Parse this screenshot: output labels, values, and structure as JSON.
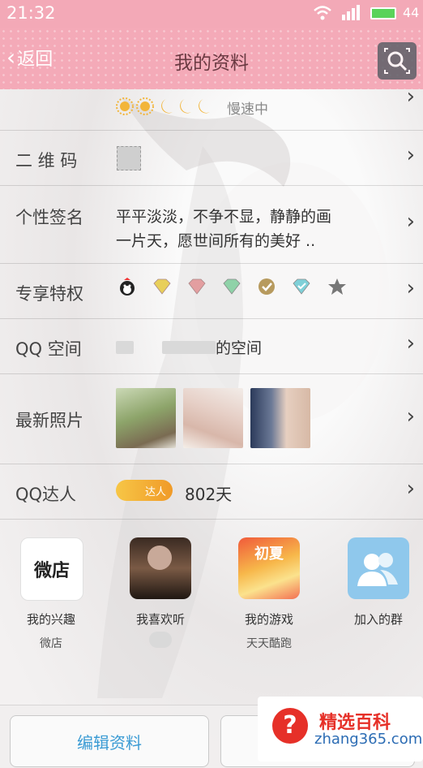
{
  "status": {
    "time": "21:32",
    "battery_text": "44"
  },
  "nav": {
    "back_label": "返回",
    "title": "我的资料"
  },
  "level": {
    "text": "慢速中"
  },
  "rows": {
    "qrcode": {
      "label": "二 维 码"
    },
    "signature": {
      "label": "个性签名",
      "line1": "平平淡淡，不争不显，静静的画",
      "line2": "一片天，愿世间所有的美好 .."
    },
    "privileges": {
      "label": "专享特权"
    },
    "qzone": {
      "label": "QQ 空间",
      "suffix": "的空间"
    },
    "photos": {
      "label": "最新照片"
    },
    "talent": {
      "label": "QQ达人",
      "badge": "达人",
      "days": "802天"
    }
  },
  "tiles": [
    {
      "icon_text": "微店",
      "label": "我的兴趣",
      "sub": "微店"
    },
    {
      "label": "我喜欢听",
      "sub": ""
    },
    {
      "icon_text": "初夏",
      "label": "我的游戏",
      "sub": "天天酷跑"
    },
    {
      "label": "加入的群",
      "sub": ""
    }
  ],
  "buttons": {
    "edit": "编辑资料"
  },
  "watermark": {
    "name": "精选百科",
    "url": "zhang365.com"
  },
  "colors": {
    "navbar": "#f4aab8",
    "accent_blue": "#3a9bd4",
    "watermark_red": "#e63028"
  }
}
